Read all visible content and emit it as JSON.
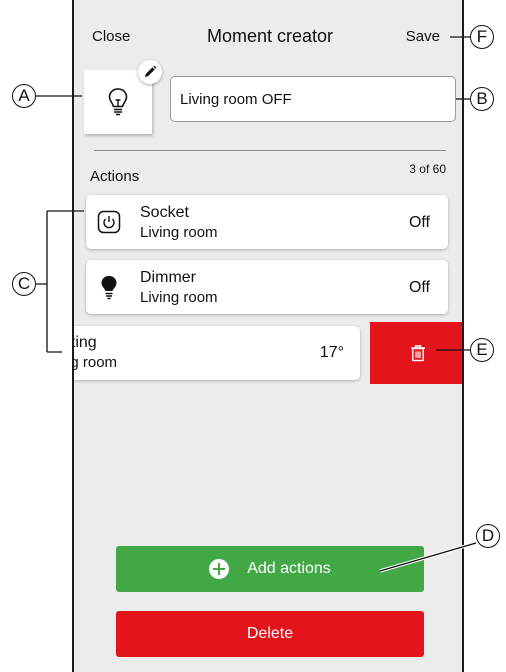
{
  "header": {
    "close_label": "Close",
    "title": "Moment creator",
    "save_label": "Save"
  },
  "moment": {
    "icon": "lightbulb-icon",
    "name_value": "Living room OFF"
  },
  "actions": {
    "title": "Actions",
    "count": "3 of 60",
    "items": [
      {
        "icon": "power-icon",
        "name": "Socket",
        "room": "Living room",
        "value": "Off"
      },
      {
        "icon": "bulb-icon",
        "name": "Dimmer",
        "room": "Living room",
        "value": "Off"
      }
    ],
    "swiped_item": {
      "name_visible": "ating",
      "room_visible": "ng room",
      "value": "17°"
    }
  },
  "buttons": {
    "add_label": "Add actions",
    "delete_label": "Delete"
  },
  "callouts": {
    "a": "A",
    "b": "B",
    "c": "C",
    "d": "D",
    "e": "E",
    "f": "F"
  },
  "colors": {
    "background": "#ececec",
    "danger": "#e3141b",
    "success": "#42a846"
  }
}
